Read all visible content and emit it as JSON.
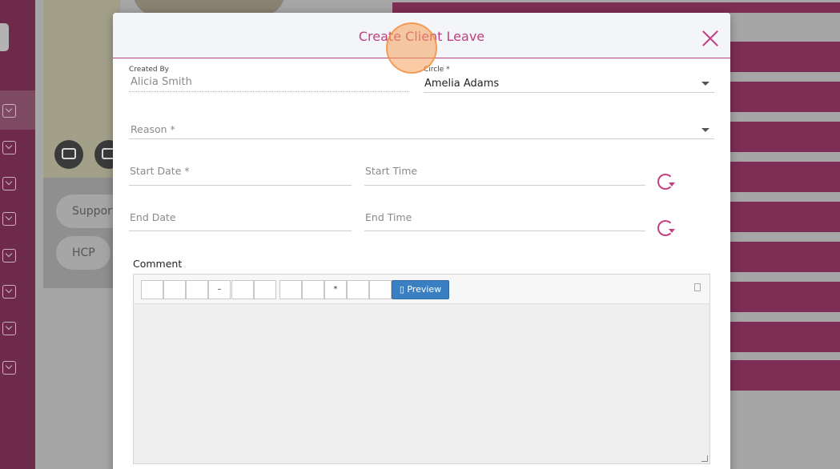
{
  "background": {
    "pills": [
      "Support",
      "HCP"
    ]
  },
  "modal": {
    "title": "Create Client Leave",
    "created_by": {
      "label": "Created By",
      "value": "Alicia Smith"
    },
    "circle": {
      "label": "Circle *",
      "value": "Amelia Adams"
    },
    "reason": {
      "placeholder": "Reason *"
    },
    "start_date": {
      "placeholder": "Start Date *"
    },
    "start_time": {
      "placeholder": "Start Time"
    },
    "end_date": {
      "placeholder": "End Date"
    },
    "end_time": {
      "placeholder": "End Time"
    },
    "comment": {
      "label": "Comment",
      "toolbar": [
        "",
        "",
        "",
        "–",
        "",
        "",
        "",
        "",
        "*",
        "",
        ""
      ],
      "preview_label": "▯ Preview"
    }
  },
  "colors": {
    "accent": "#c2407f",
    "sidebar": "#6e2a4a",
    "preview_button": "#3a7fc1"
  }
}
